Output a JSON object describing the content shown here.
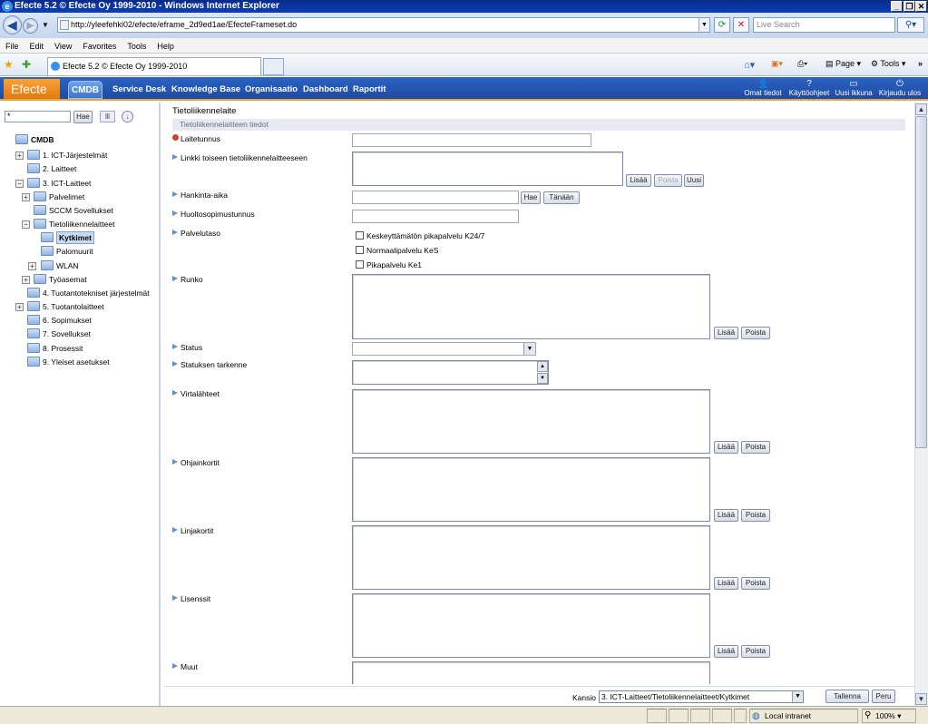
{
  "window": {
    "title": "Efecte 5.2 © Efecte Oy 1999-2010 - Windows Internet Explorer"
  },
  "browser": {
    "url": "http://yleefehki02/efecte/eframe_2d9ed1ae/EfecteFrameset.do",
    "search_placeholder": "Live Search",
    "menu": [
      "File",
      "Edit",
      "View",
      "Favorites",
      "Tools",
      "Help"
    ],
    "tab_title": "Efecte 5.2 © Efecte Oy 1999-2010",
    "cmd_page": "Page",
    "cmd_tools": "Tools"
  },
  "app": {
    "brand": "Efecte",
    "nav": {
      "cmdb": "CMDB",
      "service_desk": "Service Desk",
      "knowledge_base": "Knowledge Base",
      "organisaatio": "Organisaatio",
      "dashboard": "Dashboard",
      "raportit": "Raportit"
    },
    "right_nav": {
      "omat_tiedot": "Omat tiedot",
      "kayttoohjeet": "Käyttöohjeet",
      "uusi_ikkuna": "Uusi ikkuna",
      "kirjaudu_ulos": "Kirjaudu ulos"
    }
  },
  "tree": {
    "search_value": "*",
    "search_button": "Hae",
    "root": "CMDB",
    "items": [
      {
        "label": "1. ICT-Järjestelmät"
      },
      {
        "label": "2. Laitteet"
      },
      {
        "label": "3. ICT-Laitteet"
      },
      {
        "label": "Palvelimet"
      },
      {
        "label": "SCCM Sovellukset"
      },
      {
        "label": "Tietoliikennelaitteet"
      },
      {
        "label": "Kytkimet"
      },
      {
        "label": "Palomuurit"
      },
      {
        "label": "WLAN"
      },
      {
        "label": "Työasemat"
      },
      {
        "label": "4. Tuotantotekniset järjestelmät"
      },
      {
        "label": "5. Tuotantolaitteet"
      },
      {
        "label": "6. Sopimukset"
      },
      {
        "label": "7. Sovellukset"
      },
      {
        "label": "8. Prosessit"
      },
      {
        "label": "9. Yleiset asetukset"
      }
    ]
  },
  "form": {
    "title": "Tietoliikennelaite",
    "section": "Tietoliikennelaitteen tiedot",
    "labels": {
      "laitetunnus": "Laitetunnus",
      "linkki": "Linkki toiseen tietoliikennelaitteeseen",
      "hankinta_aika": "Hankinta-aika",
      "huoltosopimustunnus": "Huoltosopimustunnus",
      "palvelutaso": "Palvelutaso",
      "runko": "Runko",
      "status": "Status",
      "statuksen_tarkenne": "Statuksen tarkenne",
      "virtalahteet": "Virtalähteet",
      "ohjainkortit": "Ohjainkortit",
      "linjakortit": "Linjakortit",
      "lisenssit": "Lisenssit",
      "muut": "Muut"
    },
    "palvelutaso_options": [
      "Keskeyttämätön pikapalvelu K24/7",
      "Normaalipalvelu KeS",
      "Pikapalvelu Ke1"
    ],
    "buttons": {
      "lisaa": "Lisää",
      "poista": "Poista",
      "uusi": "Uusi",
      "hae": "Hae",
      "tanaan": "Tänään"
    }
  },
  "footer": {
    "kansio_label": "Kansio",
    "kansio_value": "3. ICT-Laitteet/Tietoliikennelaitteet/Kytkimet",
    "tallenna": "Tallenna",
    "peru": "Peru"
  },
  "statusbar": {
    "zone": "Local intranet",
    "zoom": "100%"
  }
}
